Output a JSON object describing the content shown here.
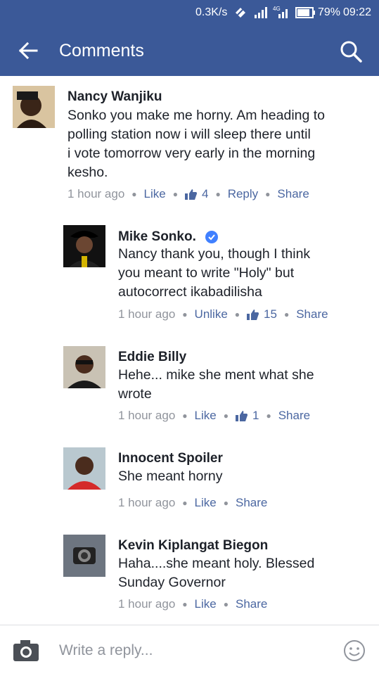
{
  "status_bar": {
    "speed": "0.3K/s",
    "battery": "79%",
    "time": "09:22"
  },
  "header": {
    "title": "Comments"
  },
  "comments": [
    {
      "name": "Nancy Wanjiku",
      "text": "Sonko you make me horny. Am  heading to\npolling station now i will sleep there until\ni vote tomorrow very early in the morning\nkesho.",
      "time": "1 hour ago",
      "action": "Like",
      "likes": "4",
      "reply": "Reply",
      "share": "Share"
    },
    {
      "name": "Mike Sonko.",
      "verified": true,
      "text": "Nancy thank you, though I think\nyou meant to write \"Holy\" but\nautocorrect ikabadilisha",
      "time": "1 hour ago",
      "action": "Unlike",
      "likes": "15",
      "share": "Share"
    },
    {
      "name": "Eddie Billy",
      "text": "Hehe... mike she ment what she\nwrote",
      "time": "1 hour ago",
      "action": "Like",
      "likes": "1",
      "share": "Share"
    },
    {
      "name": "Innocent Spoiler",
      "text": "She meant horny",
      "time": "1 hour ago",
      "action": "Like",
      "share": "Share"
    },
    {
      "name": "Kevin Kiplangat Biegon",
      "text": "Haha....she meant holy. Blessed\nSunday Governor",
      "time": "1 hour ago",
      "action": "Like",
      "share": "Share"
    }
  ],
  "composer": {
    "placeholder": "Write a reply..."
  },
  "colors": {
    "brand": "#3b5998",
    "link": "#4b67a1",
    "meta": "#90949c",
    "text": "#1d2129"
  }
}
